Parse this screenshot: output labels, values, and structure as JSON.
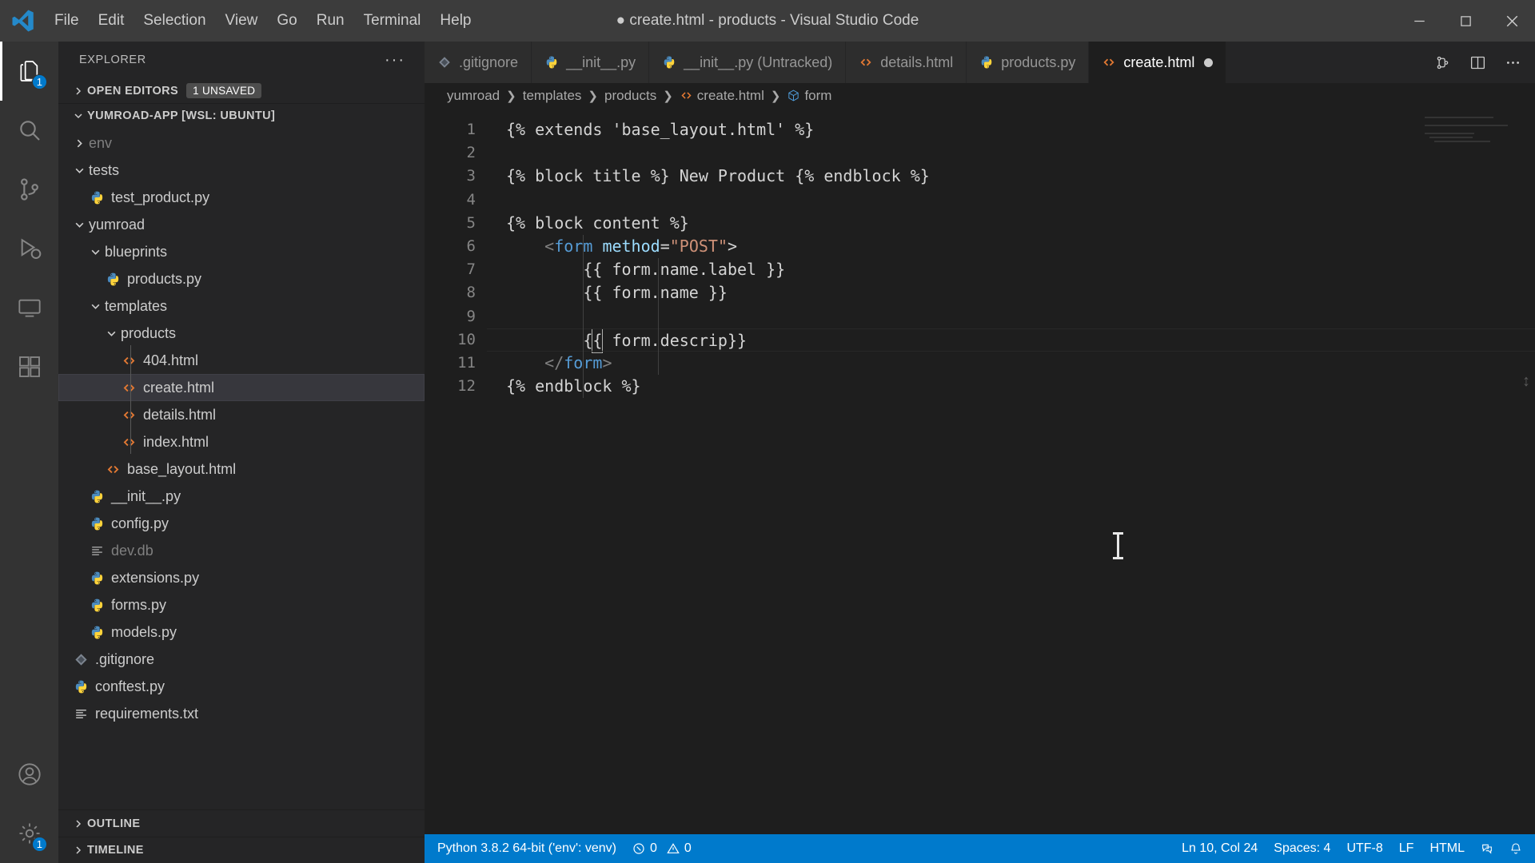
{
  "window": {
    "title": "● create.html - products - Visual Studio Code",
    "menus": [
      "File",
      "Edit",
      "Selection",
      "View",
      "Go",
      "Run",
      "Terminal",
      "Help"
    ],
    "controls": [
      "minimize-button",
      "maximize-button",
      "close-button"
    ]
  },
  "activitybar": {
    "items": [
      {
        "name": "explorer",
        "icon": "files-icon",
        "badge": "1",
        "active": true
      },
      {
        "name": "search",
        "icon": "search-icon",
        "badge": "",
        "active": false
      },
      {
        "name": "source-control",
        "icon": "source-control-icon",
        "badge": "",
        "active": false
      },
      {
        "name": "run-and-debug",
        "icon": "debug-icon",
        "badge": "",
        "active": false
      },
      {
        "name": "remote-explorer",
        "icon": "remote-icon",
        "badge": "",
        "active": false
      },
      {
        "name": "extensions",
        "icon": "extensions-icon",
        "badge": "",
        "active": false
      }
    ],
    "bottom": [
      {
        "name": "accounts",
        "icon": "account-icon",
        "badge": ""
      },
      {
        "name": "manage",
        "icon": "gear-icon",
        "badge": "1"
      }
    ]
  },
  "sidebar": {
    "header": "EXPLORER",
    "more_actions": "···",
    "open_editors": {
      "label": "OPEN EDITORS",
      "badge": "1 UNSAVED",
      "expanded": false
    },
    "workspace": {
      "label": "YUMROAD-APP [WSL: UBUNTU]",
      "expanded": true
    },
    "tree": [
      {
        "label": "env",
        "indent": 1,
        "type": "folder",
        "expanded": false,
        "dim": true
      },
      {
        "label": "tests",
        "indent": 1,
        "type": "folder",
        "expanded": true,
        "dim": false
      },
      {
        "label": "test_product.py",
        "indent": 2,
        "type": "python",
        "dim": false
      },
      {
        "label": "yumroad",
        "indent": 1,
        "type": "folder",
        "expanded": true,
        "dim": false
      },
      {
        "label": "blueprints",
        "indent": 2,
        "type": "folder",
        "expanded": true,
        "dim": false
      },
      {
        "label": "products.py",
        "indent": 3,
        "type": "python",
        "dim": false
      },
      {
        "label": "templates",
        "indent": 2,
        "type": "folder",
        "expanded": true,
        "dim": false
      },
      {
        "label": "products",
        "indent": 3,
        "type": "folder",
        "expanded": true,
        "dim": false
      },
      {
        "label": "404.html",
        "indent": 4,
        "type": "html",
        "dim": false
      },
      {
        "label": "create.html",
        "indent": 4,
        "type": "html",
        "dim": false,
        "selected": true
      },
      {
        "label": "details.html",
        "indent": 4,
        "type": "html",
        "dim": false
      },
      {
        "label": "index.html",
        "indent": 4,
        "type": "html",
        "dim": false
      },
      {
        "label": "base_layout.html",
        "indent": 3,
        "type": "html",
        "dim": false
      },
      {
        "label": "__init__.py",
        "indent": 2,
        "type": "python",
        "dim": false
      },
      {
        "label": "config.py",
        "indent": 2,
        "type": "python",
        "dim": false
      },
      {
        "label": "dev.db",
        "indent": 2,
        "type": "db",
        "dim": true
      },
      {
        "label": "extensions.py",
        "indent": 2,
        "type": "python",
        "dim": false
      },
      {
        "label": "forms.py",
        "indent": 2,
        "type": "python",
        "dim": false
      },
      {
        "label": "models.py",
        "indent": 2,
        "type": "python",
        "dim": false
      },
      {
        "label": ".gitignore",
        "indent": 1,
        "type": "git",
        "dim": false
      },
      {
        "label": "conftest.py",
        "indent": 1,
        "type": "python",
        "dim": false
      },
      {
        "label": "requirements.txt",
        "indent": 1,
        "type": "text",
        "dim": false
      }
    ],
    "sections": [
      {
        "label": "OUTLINE",
        "expanded": false
      },
      {
        "label": "TIMELINE",
        "expanded": false
      }
    ]
  },
  "editor": {
    "tabs": [
      {
        "label": ".gitignore",
        "type": "git",
        "active": false,
        "dirty": false
      },
      {
        "label": "__init__.py",
        "type": "python",
        "active": false,
        "dirty": false
      },
      {
        "label": "__init__.py (Untracked)",
        "type": "python",
        "active": false,
        "dirty": false
      },
      {
        "label": "details.html",
        "type": "html",
        "active": false,
        "dirty": false
      },
      {
        "label": "products.py",
        "type": "python",
        "active": false,
        "dirty": false
      },
      {
        "label": "create.html",
        "type": "html",
        "active": true,
        "dirty": true
      }
    ],
    "tab_actions": [
      "split-editor-icon",
      "split-editor-right-icon",
      "more-actions-icon"
    ],
    "breadcrumb": [
      "yumroad",
      "templates",
      "products",
      "create.html",
      "form"
    ],
    "lines": [
      {
        "n": "1",
        "text": "{% extends 'base_layout.html' %}"
      },
      {
        "n": "2",
        "text": ""
      },
      {
        "n": "3",
        "text": "{% block title %} New Product {% endblock %}"
      },
      {
        "n": "4",
        "text": ""
      },
      {
        "n": "5",
        "text": "{% block content %}"
      },
      {
        "n": "6",
        "text": "    <form method=\"POST\">"
      },
      {
        "n": "7",
        "text": "        {{ form.name.label }}"
      },
      {
        "n": "8",
        "text": "        {{ form.name }}"
      },
      {
        "n": "9",
        "text": ""
      },
      {
        "n": "10",
        "text": "        {{ form.descrip}}"
      },
      {
        "n": "11",
        "text": "    </form>"
      },
      {
        "n": "12",
        "text": "{% endblock %}"
      }
    ]
  },
  "statusbar": {
    "left": [
      {
        "name": "python-interpreter",
        "icon": "",
        "label": "Python 3.8.2 64-bit ('env': venv)"
      },
      {
        "name": "problems",
        "icon": "error-warning",
        "errors": "0",
        "warnings": "0"
      }
    ],
    "right": [
      {
        "name": "cursor-position",
        "label": "Ln 10, Col 24"
      },
      {
        "name": "indentation",
        "label": "Spaces: 4"
      },
      {
        "name": "encoding",
        "label": "UTF-8"
      },
      {
        "name": "eol",
        "label": "LF"
      },
      {
        "name": "language-mode",
        "label": "HTML"
      },
      {
        "name": "live-share",
        "label": ""
      },
      {
        "name": "notifications",
        "label": ""
      }
    ]
  },
  "colors": {
    "accent": "#007acc",
    "titlebar": "#3c3c3c",
    "sidebar": "#252526",
    "editor": "#1e1e1e",
    "activitybar": "#333333",
    "html_icon": "#e37933",
    "python_icon": "#3c78aa",
    "selected_row": "#37373d"
  }
}
